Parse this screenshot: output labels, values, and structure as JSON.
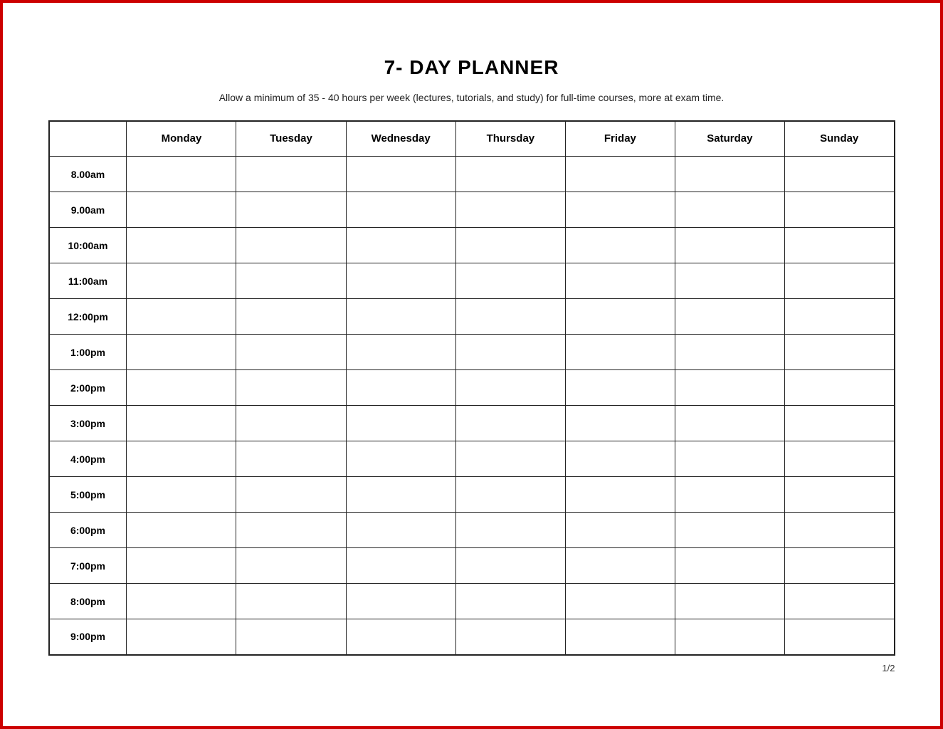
{
  "page": {
    "title": "7- DAY PLANNER",
    "subtitle": "Allow a minimum of 35 - 40 hours per week (lectures, tutorials, and study) for full-time courses, more at exam time.",
    "page_number": "1/2"
  },
  "table": {
    "headers": [
      "",
      "Monday",
      "Tuesday",
      "Wednesday",
      "Thursday",
      "Friday",
      "Saturday",
      "Sunday"
    ],
    "time_slots": [
      "8.00am",
      "9.00am",
      "10:00am",
      "11:00am",
      "12:00pm",
      "1:00pm",
      "2:00pm",
      "3:00pm",
      "4:00pm",
      "5:00pm",
      "6:00pm",
      "7:00pm",
      "8:00pm",
      "9:00pm"
    ]
  }
}
